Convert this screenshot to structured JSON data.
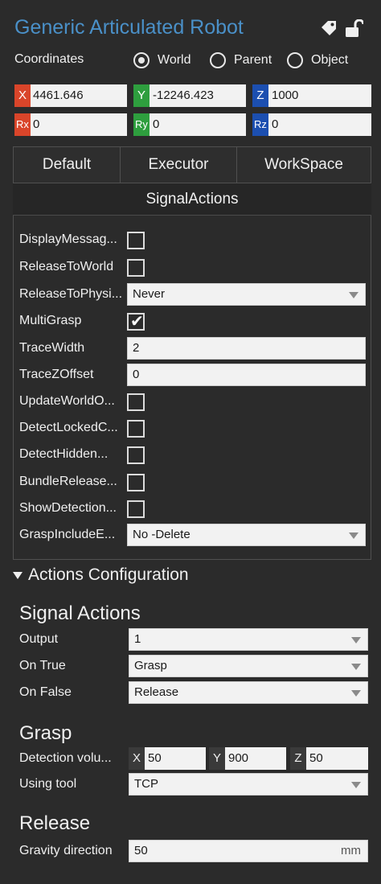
{
  "header": {
    "title": "Generic Articulated Robot",
    "tag_icon": "tag-icon",
    "lock_icon": "unlock-icon"
  },
  "coordinates": {
    "label": "Coordinates",
    "options": [
      "World",
      "Parent",
      "Object"
    ],
    "selected": "World",
    "fields": [
      {
        "tag": "X",
        "value": "4461.646",
        "color": "#d9452a"
      },
      {
        "tag": "Y",
        "value": "-12246.423",
        "color": "#2e9e3e"
      },
      {
        "tag": "Z",
        "value": "1000",
        "color": "#1c4fb0"
      },
      {
        "tag": "Rx",
        "value": "0",
        "color": "#d9452a"
      },
      {
        "tag": "Ry",
        "value": "0",
        "color": "#2e9e3e"
      },
      {
        "tag": "Rz",
        "value": "0",
        "color": "#1c4fb0"
      }
    ]
  },
  "tabs": [
    "Default",
    "Executor",
    "WorkSpace"
  ],
  "panel": {
    "title": "SignalActions",
    "rows": [
      {
        "label": "DisplayMessag...",
        "type": "checkbox",
        "checked": false
      },
      {
        "label": "ReleaseToWorld",
        "type": "checkbox",
        "checked": false
      },
      {
        "label": "ReleaseToPhysi...",
        "type": "dropdown",
        "value": "Never"
      },
      {
        "label": "MultiGrasp",
        "type": "checkbox",
        "checked": true
      },
      {
        "label": "TraceWidth",
        "type": "text",
        "value": "2"
      },
      {
        "label": "TraceZOffset",
        "type": "text",
        "value": "0"
      },
      {
        "label": "UpdateWorldO...",
        "type": "checkbox",
        "checked": false
      },
      {
        "label": "DetectLockedC...",
        "type": "checkbox",
        "checked": false
      },
      {
        "label": "DetectHidden...",
        "type": "checkbox",
        "checked": false
      },
      {
        "label": "BundleRelease...",
        "type": "checkbox",
        "checked": false
      },
      {
        "label": "ShowDetection...",
        "type": "checkbox",
        "checked": false
      },
      {
        "label": "GraspIncludeE...",
        "type": "dropdown",
        "value": "No -Delete"
      }
    ]
  },
  "actions_config": {
    "heading": "Actions Configuration",
    "signal_actions": {
      "heading": "Signal Actions",
      "output_label": "Output",
      "output_value": "1",
      "on_true_label": "On True",
      "on_true_value": "Grasp",
      "on_false_label": "On False",
      "on_false_value": "Release"
    },
    "grasp": {
      "heading": "Grasp",
      "detection_label": "Detection volu...",
      "x_tag": "X",
      "x_value": "50",
      "y_tag": "Y",
      "y_value": "900",
      "z_tag": "Z",
      "z_value": "50",
      "tool_label": "Using tool",
      "tool_value": "TCP"
    },
    "release": {
      "heading": "Release",
      "gravity_label": "Gravity direction",
      "gravity_value": "50",
      "gravity_unit": "mm"
    }
  }
}
